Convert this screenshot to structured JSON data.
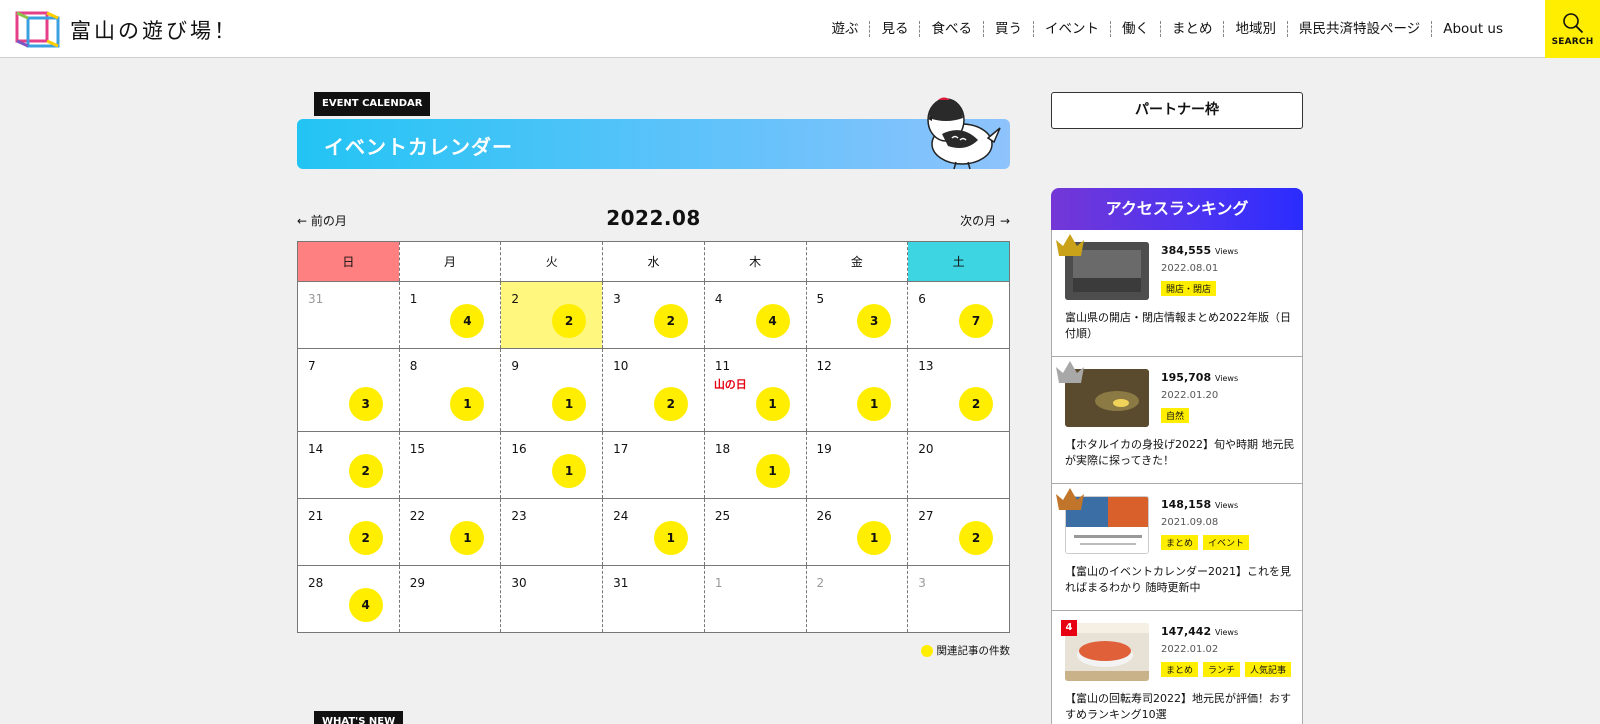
{
  "header": {
    "site_name": "富山の遊び場！",
    "nav": [
      "遊ぶ",
      "見る",
      "食べる",
      "買う",
      "イベント",
      "働く",
      "まとめ",
      "地域別",
      "県民共済特設ページ",
      "About us"
    ],
    "search_label": "SEARCH"
  },
  "event_calendar": {
    "badge": "EVENT CALENDAR",
    "title": "イベントカレンダー",
    "prev_month": "前の月",
    "next_month": "次の月",
    "month": "2022.08",
    "weekdays": [
      "日",
      "月",
      "火",
      "水",
      "木",
      "金",
      "土"
    ],
    "weeks": [
      [
        {
          "day": "31",
          "other": true
        },
        {
          "day": "1",
          "count": "4"
        },
        {
          "day": "2",
          "count": "2",
          "today": true
        },
        {
          "day": "3",
          "count": "2"
        },
        {
          "day": "4",
          "count": "4"
        },
        {
          "day": "5",
          "count": "3"
        },
        {
          "day": "6",
          "count": "7"
        }
      ],
      [
        {
          "day": "7",
          "count": "3"
        },
        {
          "day": "8",
          "count": "1"
        },
        {
          "day": "9",
          "count": "1"
        },
        {
          "day": "10",
          "count": "2"
        },
        {
          "day": "11",
          "count": "1",
          "holiday": "山の日"
        },
        {
          "day": "12",
          "count": "1"
        },
        {
          "day": "13",
          "count": "2"
        }
      ],
      [
        {
          "day": "14",
          "count": "2"
        },
        {
          "day": "15"
        },
        {
          "day": "16",
          "count": "1"
        },
        {
          "day": "17"
        },
        {
          "day": "18",
          "count": "1"
        },
        {
          "day": "19"
        },
        {
          "day": "20"
        }
      ],
      [
        {
          "day": "21",
          "count": "2"
        },
        {
          "day": "22",
          "count": "1"
        },
        {
          "day": "23"
        },
        {
          "day": "24",
          "count": "1"
        },
        {
          "day": "25"
        },
        {
          "day": "26",
          "count": "1"
        },
        {
          "day": "27",
          "count": "2"
        }
      ],
      [
        {
          "day": "28",
          "count": "4"
        },
        {
          "day": "29"
        },
        {
          "day": "30"
        },
        {
          "day": "31"
        },
        {
          "day": "1",
          "other": true
        },
        {
          "day": "2",
          "other": true
        },
        {
          "day": "3",
          "other": true
        }
      ]
    ],
    "legend": "関連記事の件数"
  },
  "whats_new": {
    "badge": "WHAT'S NEW"
  },
  "sidebar": {
    "partner": "パートナー枠",
    "ranking_title": "アクセスランキング",
    "ranking": [
      {
        "rank": "1",
        "views": "384,555",
        "views_unit": "Views",
        "date": "2022.08.01",
        "tags": [
          "開店・閉店"
        ],
        "title": "富山県の開店・閉店情報まとめ2022年版（日付順）",
        "thumb_text": "開店・閉店情報まとめ"
      },
      {
        "rank": "2",
        "views": "195,708",
        "views_unit": "Views",
        "date": "2022.01.20",
        "tags": [
          "自然"
        ],
        "title": "【ホタルイカの身投げ2022】旬や時期 地元民が実際に探ってきた！"
      },
      {
        "rank": "3",
        "views": "148,158",
        "views_unit": "Views",
        "date": "2021.09.08",
        "tags": [
          "まとめ",
          "イベント"
        ],
        "title": "【富山のイベントカレンダー2021】これを見ればまるわかり 随時更新中",
        "thumb_text": "富山の最新イベントカレンダー"
      },
      {
        "rank": "4",
        "views": "147,442",
        "views_unit": "Views",
        "date": "2022.01.02",
        "tags": [
          "まとめ",
          "ランチ",
          "人気記事"
        ],
        "title": "【富山の回転寿司2022】地元民が評価！おすすめランキング10選",
        "thumb_text": "おすすめランキング"
      }
    ]
  },
  "colors": {
    "accent_yellow": "#ffee00",
    "sunday": "#ff8080",
    "saturday": "#3dd5e1",
    "today": "#fff77e",
    "holiday": "#e60012"
  }
}
